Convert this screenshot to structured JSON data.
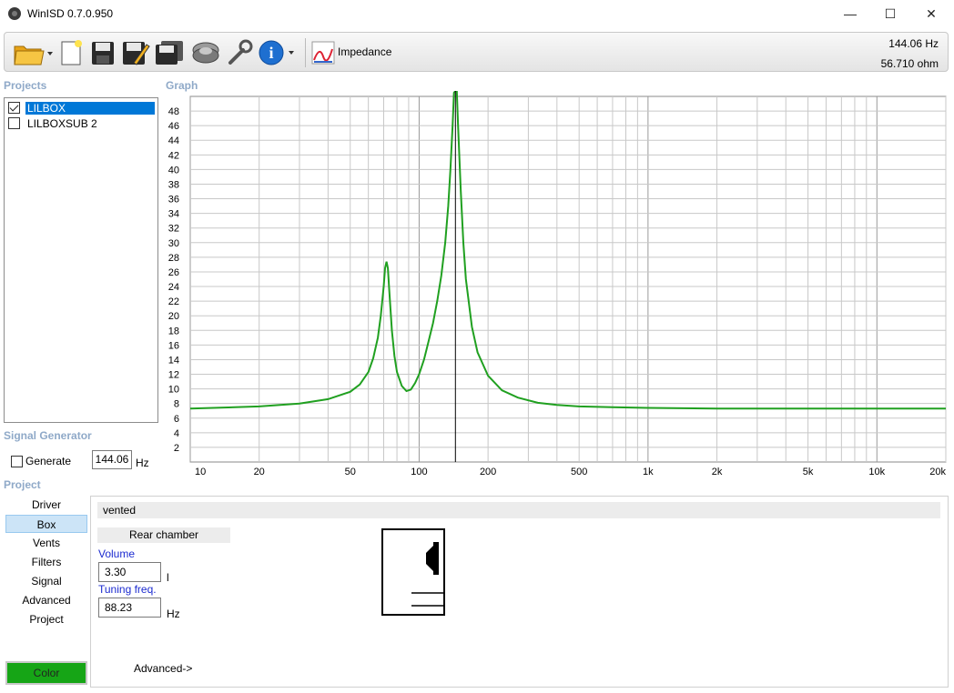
{
  "window": {
    "title": "WinISD 0.7.0.950",
    "minimize": "—",
    "maximize": "☐",
    "close": "✕"
  },
  "toolbar": {
    "graph_label": "Impedance",
    "freq_readout": "144.06 Hz",
    "ohm_readout": "56.710 ohm"
  },
  "projects": {
    "header": "Projects",
    "items": [
      {
        "label": "LILBOX",
        "checked": true,
        "selected": true
      },
      {
        "label": "LILBOXSUB 2",
        "checked": false,
        "selected": false
      }
    ]
  },
  "graph": {
    "header": "Graph"
  },
  "signal_generator": {
    "header": "Signal Generator",
    "generate_label": "Generate",
    "generate_checked": false,
    "frequency": "144.06",
    "unit": "Hz"
  },
  "project_nav": {
    "header": "Project",
    "items": [
      "Driver",
      "Box",
      "Vents",
      "Filters",
      "Signal",
      "Advanced",
      "Project"
    ],
    "active": "Box",
    "color_button": "Color"
  },
  "box_panel": {
    "box_type": "vented",
    "rear_chamber_label": "Rear chamber",
    "volume_label": "Volume",
    "volume_value": "3.30",
    "volume_unit": "l",
    "tuning_label": "Tuning freq.",
    "tuning_value": "88.23",
    "tuning_unit": "Hz",
    "advanced_link": "Advanced->"
  },
  "colors": {
    "curve": "#20a020",
    "selection": "#0078d7",
    "color_swatch": "#16a516",
    "section_label": "#8fa9c8"
  },
  "chart_data": {
    "type": "line",
    "xscale": "log",
    "xlim": [
      10,
      20000
    ],
    "ylim": [
      0,
      50
    ],
    "xticks": [
      10,
      20,
      50,
      100,
      200,
      500,
      1000,
      2000,
      5000,
      10000,
      20000
    ],
    "xtick_labels": [
      "10",
      "20",
      "50",
      "100",
      "200",
      "500",
      "1k",
      "2k",
      "5k",
      "10k",
      "20k"
    ],
    "yticks": [
      2,
      4,
      6,
      8,
      10,
      12,
      14,
      16,
      18,
      20,
      22,
      24,
      26,
      28,
      30,
      32,
      34,
      36,
      38,
      40,
      42,
      44,
      46,
      48
    ],
    "grid": true,
    "cursor_x": 144.06,
    "series": [
      {
        "x": [
          10,
          20,
          30,
          40,
          50,
          55,
          60,
          63,
          66,
          68,
          70,
          71,
          72,
          73,
          74,
          76,
          78,
          80,
          84,
          88,
          92,
          96,
          100,
          105,
          110,
          115,
          120,
          125,
          130,
          134,
          137,
          140,
          142,
          144,
          146,
          148,
          152,
          156,
          160,
          170,
          180,
          200,
          230,
          270,
          330,
          400,
          500,
          700,
          1000,
          2000,
          5000,
          10000,
          20000
        ],
        "y": [
          7.3,
          7.6,
          8.0,
          8.6,
          9.6,
          10.6,
          12.3,
          14.2,
          17.0,
          20.0,
          24.0,
          26.5,
          27.4,
          26.5,
          23.5,
          18.0,
          14.5,
          12.3,
          10.4,
          9.7,
          9.9,
          10.8,
          12.0,
          14.0,
          16.5,
          19.0,
          22.0,
          25.5,
          30.0,
          35.0,
          40.0,
          46.0,
          50.5,
          53.0,
          51.0,
          46.0,
          37.0,
          30.0,
          25.0,
          18.5,
          15.0,
          11.8,
          9.8,
          8.8,
          8.1,
          7.8,
          7.6,
          7.5,
          7.4,
          7.3,
          7.3,
          7.3,
          7.3
        ]
      }
    ]
  }
}
